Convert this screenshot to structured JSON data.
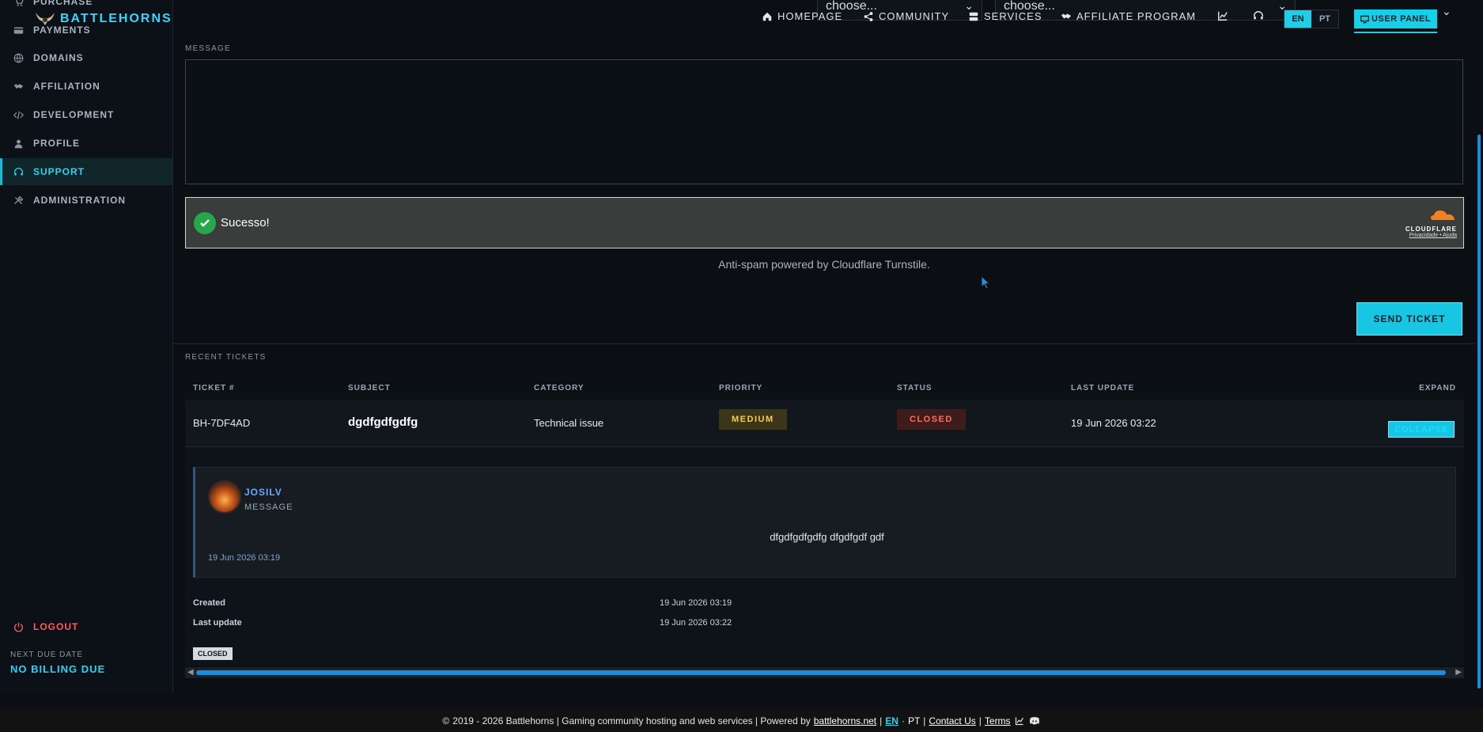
{
  "brand": {
    "name": "BATTLEHORNS"
  },
  "sidebar": {
    "items": [
      {
        "label": "PURCHASE",
        "icon": "cart-icon"
      },
      {
        "label": "PAYMENTS",
        "icon": "wallet-icon"
      },
      {
        "label": "DOMAINS",
        "icon": "globe-icon"
      },
      {
        "label": "AFFILIATION",
        "icon": "handshake-icon"
      },
      {
        "label": "DEVELOPMENT",
        "icon": "code-icon"
      },
      {
        "label": "PROFILE",
        "icon": "user-icon"
      },
      {
        "label": "SUPPORT",
        "icon": "headset-icon",
        "active": true
      },
      {
        "label": "ADMINISTRATION",
        "icon": "tools-icon"
      }
    ],
    "logout": "LOGOUT",
    "due_label": "NEXT DUE DATE",
    "due_value": "NO BILLING DUE"
  },
  "topbar": {
    "select_1": "choose...",
    "select_2": "choose...",
    "nav": [
      "HOMEPAGE",
      "COMMUNITY",
      "SERVICES",
      "AFFILIATE PROGRAM"
    ],
    "lang": [
      "EN",
      "PT"
    ],
    "user_panel": "USER PANEL"
  },
  "form": {
    "message_label": "MESSAGE",
    "message_value": "",
    "turnstile_status": "Sucesso!",
    "cloudflare_brand": "CLOUDFLARE",
    "cloudflare_links": "Privacidade • Ajuda",
    "antispam_note": "Anti-spam powered by Cloudflare Turnstile.",
    "send_label": "SEND TICKET"
  },
  "tickets": {
    "section_label": "RECENT TICKETS",
    "columns": [
      "TICKET #",
      "SUBJECT",
      "CATEGORY",
      "PRIORITY",
      "STATUS",
      "LAST UPDATE",
      "EXPAND"
    ],
    "rows": [
      {
        "id": "BH-7DF4AD",
        "subject": "dgdfgdfgdfg",
        "category": "Technical issue",
        "priority": "MEDIUM",
        "status": "CLOSED",
        "last_update": "19 Jun 2026 03:22",
        "expand_label": "COLLAPSE"
      }
    ],
    "detail": {
      "author": "JOSILV",
      "kind": "MESSAGE",
      "body": "dfgdfgdfgdfg dfgdfgdf gdf",
      "date": "19 Jun 2026 03:19",
      "created_label": "Created",
      "created_value": "19 Jun 2026 03:19",
      "updated_label": "Last update",
      "updated_value": "19 Jun 2026 03:22",
      "status_tag": "CLOSED"
    }
  },
  "footer": {
    "copyright": "2019 - 2026 Battlehorns | Gaming community hosting and web services | Powered by",
    "powered_link": "battlehorns.net",
    "sep1": "|",
    "lang_en": "EN",
    "lang_sep": "·",
    "lang_pt": "PT",
    "sep2": "|",
    "contact": "Contact Us",
    "sep3": "|",
    "terms": "Terms"
  },
  "colors": {
    "accent": "#17c6e3",
    "danger": "#ff5a5a",
    "warning": "#f0cf57",
    "panel": "#0e1319"
  }
}
